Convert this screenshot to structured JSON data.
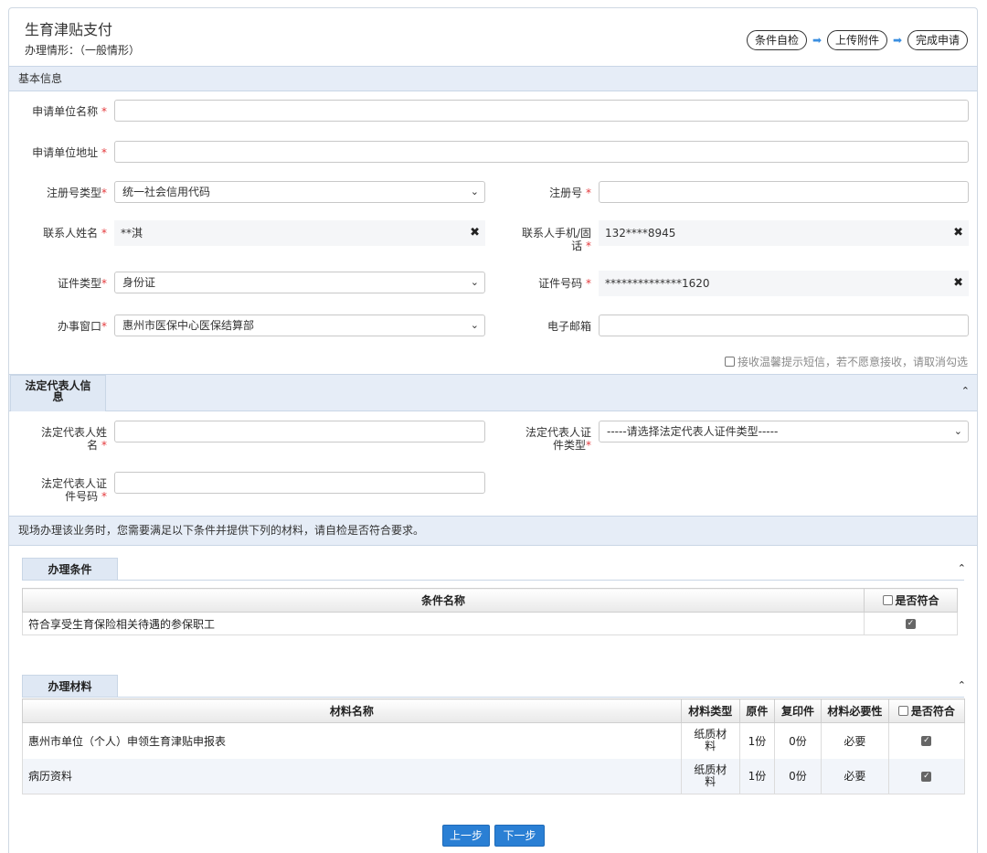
{
  "header": {
    "title": "生育津贴支付",
    "subtitle": "办理情形：（一般情形）",
    "steps": [
      "条件自检",
      "上传附件",
      "完成申请"
    ]
  },
  "basic": {
    "section_title": "基本信息",
    "unit_name_label": "申请单位名称",
    "unit_address_label": "申请单位地址",
    "reg_type_label": "注册号类型",
    "reg_type_value": "统一社会信用代码",
    "reg_no_label": "注册号",
    "contact_name_label": "联系人姓名",
    "contact_name_value": "**淇",
    "contact_phone_label_1": "联系人手机/固",
    "contact_phone_label_2": "话",
    "contact_phone_value": "132****8945",
    "id_type_label": "证件类型",
    "id_type_value": "身份证",
    "id_no_label": "证件号码",
    "id_no_value": "**************1620",
    "window_label": "办事窗口",
    "window_value": "惠州市医保中心医保结算部",
    "email_label": "电子邮箱",
    "sms_text": "接收温馨提示短信，若不愿意接收，请取消勾选",
    "required_mark": "*"
  },
  "legal": {
    "tab_title_1": "法定代表人信",
    "tab_title_2": "息",
    "name_label_1": "法定代表人姓",
    "name_label_2": "名",
    "id_type_label_1": "法定代表人证",
    "id_type_label_2": "件类型",
    "id_type_placeholder": "-----请选择法定代表人证件类型-----",
    "id_no_label_1": "法定代表人证",
    "id_no_label_2": "件号码"
  },
  "notice": "现场办理该业务时，您需要满足以下条件并提供下列的材料，请自检是否符合要求。",
  "conditions": {
    "tab_title": "办理条件",
    "headers": [
      "条件名称",
      "是否符合"
    ],
    "rows": [
      {
        "name": "符合享受生育保险相关待遇的参保职工",
        "checked": true
      }
    ]
  },
  "materials": {
    "tab_title": "办理材料",
    "headers": [
      "材料名称",
      "材料类型",
      "原件",
      "复印件",
      "材料必要性",
      "是否符合"
    ],
    "rows": [
      {
        "name": "惠州市单位（个人）申领生育津贴申报表",
        "type_1": "纸质材",
        "type_2": "料",
        "original": "1份",
        "copy": "0份",
        "necessity": "必要",
        "checked": true
      },
      {
        "name": "病历资料",
        "type_1": "纸质材",
        "type_2": "料",
        "original": "1份",
        "copy": "0份",
        "necessity": "必要",
        "checked": true
      }
    ]
  },
  "buttons": {
    "prev": "上一步",
    "next": "下一步"
  },
  "colors": {
    "accent": "#2a7fd4",
    "section_bg": "#e6edf7",
    "required": "#e4393c"
  }
}
